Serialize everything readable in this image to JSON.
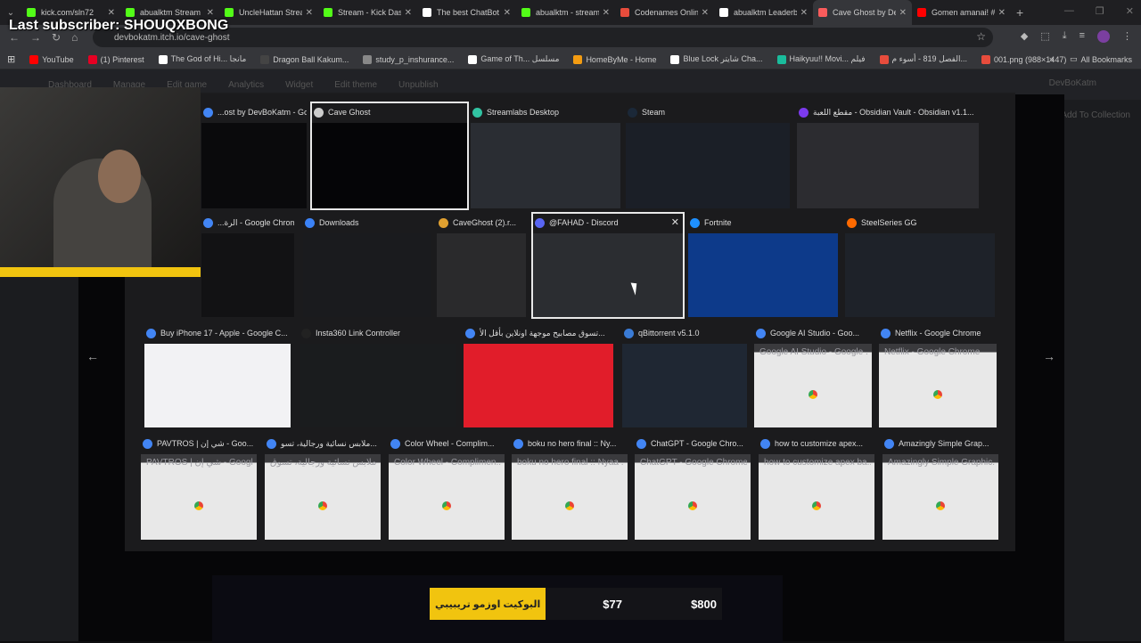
{
  "tabs": [
    {
      "title": "kick.com/sln72",
      "color": "#53fc18",
      "active": false
    },
    {
      "title": "abualktm Stream",
      "color": "#53fc18",
      "active": false
    },
    {
      "title": "UncleHattan Strea",
      "color": "#53fc18",
      "active": false
    },
    {
      "title": "Stream - Kick Das",
      "color": "#53fc18",
      "active": false
    },
    {
      "title": "The best ChatBot",
      "color": "#ffffff",
      "active": false
    },
    {
      "title": "abualktm - stream",
      "color": "#53fc18",
      "active": false
    },
    {
      "title": "Codenames Onlin",
      "color": "#e74c3c",
      "active": false
    },
    {
      "title": "abualktm Leaderb",
      "color": "#ffffff",
      "active": false
    },
    {
      "title": "Cave Ghost by De",
      "color": "#fa5c5c",
      "active": true
    },
    {
      "title": "Gomen amanai! #",
      "color": "#ff0000",
      "active": false
    }
  ],
  "address": {
    "url": "devbokatm.itch.io/cave-ghost"
  },
  "bookmarks": [
    {
      "label": "YouTube",
      "color": "#ff0000"
    },
    {
      "label": "(1) Pinterest",
      "color": "#e60023"
    },
    {
      "label": "The God of Hi... مانجا",
      "color": "#ffffff"
    },
    {
      "label": "Dragon Ball Kakum...",
      "color": "#444444"
    },
    {
      "label": "study_p_inshurance...",
      "color": "#888888"
    },
    {
      "label": "Game of Th... مسلسل",
      "color": "#ffffff"
    },
    {
      "label": "HomeByMe - Home",
      "color": "#f39c12"
    },
    {
      "label": "Blue Lock شايتر Cha...",
      "color": "#ffffff"
    },
    {
      "label": "Haikyuu!! Movi... فيلم",
      "color": "#1abc9c"
    },
    {
      "label": "الفصل 819 - أسوء م...",
      "color": "#e74c3c"
    },
    {
      "label": "001.png (988×1447)",
      "color": "#e74c3c"
    }
  ],
  "bookmarks_all": "All Bookmarks",
  "itch": {
    "nav": [
      "Dashboard",
      "Manage",
      "Edit game",
      "Analytics",
      "Widget",
      "Edit theme",
      "Unpublish"
    ],
    "user": "DevBoKatm",
    "add_collection": "Add To Collection"
  },
  "switcher": {
    "row1": [
      {
        "title": "...ost by DevBoKatm - Goog...",
        "icon": "#4285f4"
      },
      {
        "title": "Cave Ghost",
        "icon": "#cccccc",
        "selected": true
      },
      {
        "title": "Streamlabs Desktop",
        "icon": "#31c3a2"
      },
      {
        "title": "Steam",
        "icon": "#1b2838"
      },
      {
        "title": "مقطع اللعبة - Obsidian Vault - Obsidian v1.1...",
        "icon": "#7c3aed"
      }
    ],
    "row2": [
      {
        "title": "...الرة - Google Chrome",
        "icon": "#4285f4"
      },
      {
        "title": "Downloads",
        "icon": "#3b82f6"
      },
      {
        "title": "CaveGhost (2).r...",
        "icon": "#e0a030"
      },
      {
        "title": "@FAHAD - Discord",
        "icon": "#5865f2",
        "selected": true
      },
      {
        "title": "Fortnite",
        "icon": "#1e90ff"
      },
      {
        "title": "SteelSeries GG",
        "icon": "#ff6a00"
      }
    ],
    "row3": [
      {
        "title": "Buy iPhone 17 - Apple - Google C...",
        "icon": "#4285f4"
      },
      {
        "title": "Insta360 Link Controller",
        "icon": "#222222"
      },
      {
        "title": "تسوق مصابيح موجهة اونلاين بأقل الأ...",
        "icon": "#4285f4"
      },
      {
        "title": "qBittorrent v5.1.0",
        "icon": "#3a7bd5"
      },
      {
        "title": "Google AI Studio - Goo...",
        "icon": "#4285f4",
        "placeholder": "Google AI Studio - Google ..."
      },
      {
        "title": "Netflix - Google Chrome",
        "icon": "#4285f4",
        "placeholder": "Netflix - Google Chrome"
      }
    ],
    "row4": [
      {
        "title": "PAVTROS | شي إن - Goo...",
        "placeholder": "PAVTROS | شي إن - Google..."
      },
      {
        "title": "ملابس نسائية ورجالية، تسو...",
        "placeholder": "ملابس نسائية ورجالية، تسوق"
      },
      {
        "title": "Color Wheel - Complim...",
        "placeholder": "Color Wheel - Complimen..."
      },
      {
        "title": "boku no hero final :: Ny...",
        "placeholder": "boku no hero final :: Nyaa ..."
      },
      {
        "title": "ChatGPT - Google Chro...",
        "placeholder": "ChatGPT - Google Chrome"
      },
      {
        "title": "how to customize apex...",
        "placeholder": "how to customize apex ba..."
      },
      {
        "title": "Amazingly Simple Grap...",
        "placeholder": "Amazingly Simple Graphic..."
      }
    ]
  },
  "overlay": {
    "last_subscriber": "Last subscriber: SHOUQXBONG",
    "hud_label": "البوكيت اوزمو تريبيبي",
    "hud_value1": "$77",
    "hud_value2": "$800"
  }
}
